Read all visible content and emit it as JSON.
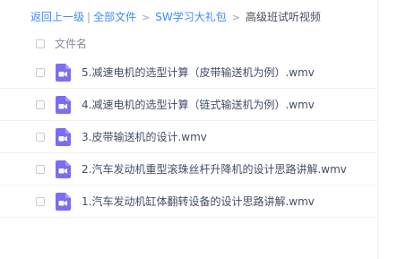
{
  "breadcrumb": {
    "back": "返回上一级",
    "separator": "|",
    "all_files": "全部文件",
    "arrow1": ">",
    "folder": "SW学习大礼包",
    "arrow2": ">",
    "current": "高级班试听视频"
  },
  "file_list": {
    "header_label": "文件名",
    "files": [
      {
        "name": "5.减速电机的选型计算（皮带输送机为例）.wmv",
        "icon": "video-file-icon"
      },
      {
        "name": "4.减速电机的选型计算（链式输送机为例）.wmv",
        "icon": "video-file-icon"
      },
      {
        "name": "3.皮带输送机的设计.wmv",
        "icon": "video-file-icon"
      },
      {
        "name": "2.汽车发动机重型滚珠丝杆升降机的设计思路讲解.wmv",
        "icon": "video-file-icon"
      },
      {
        "name": "1.汽车发动机缸体翻转设备的设计思路讲解.wmv",
        "icon": "video-file-icon"
      }
    ]
  },
  "colors": {
    "link": "#3b8cff",
    "icon": "#7b6cf6"
  }
}
